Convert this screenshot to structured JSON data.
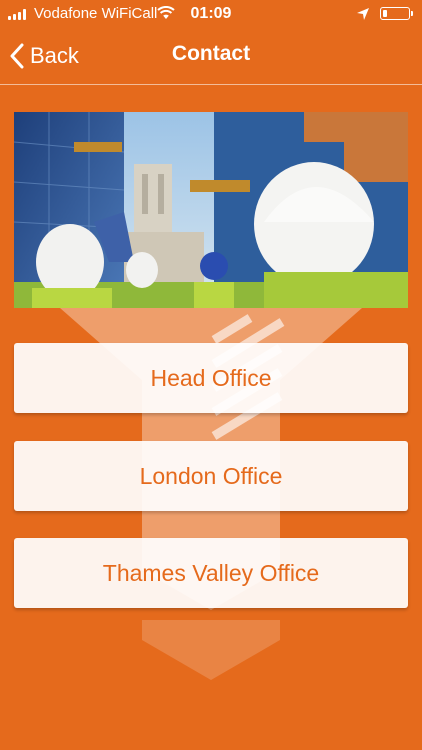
{
  "status_bar": {
    "carrier": "Vodafone WiFiCall",
    "time": "01:09",
    "signal_icon": "signal-bars-icon",
    "wifi_icon": "wifi-icon",
    "location_icon": "location-arrow-icon",
    "battery_icon": "battery-icon",
    "battery_level": 0.2
  },
  "nav": {
    "back_label": "Back",
    "back_icon": "chevron-left-icon",
    "title": "Contact"
  },
  "hero": {
    "alt": "Construction workers in hard hats looking at buildings"
  },
  "offices": [
    {
      "label": "Head Office"
    },
    {
      "label": "London Office"
    },
    {
      "label": "Thames Valley Office"
    }
  ],
  "colors": {
    "background": "#E56A1C",
    "button_background": "#FFFFFF",
    "button_text": "#E56A1C"
  }
}
